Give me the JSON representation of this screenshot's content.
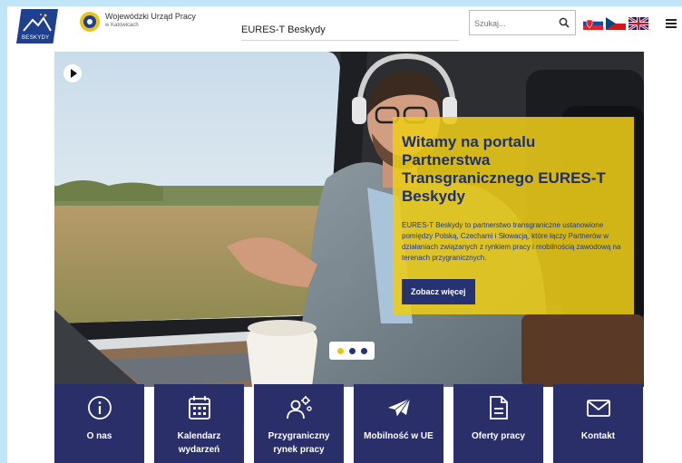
{
  "header": {
    "beskydy_logo_label": "BESKYDY",
    "wup_name_line1": "Wojewódzki Urząd Pracy",
    "wup_name_line2": "w Katowicach",
    "site_title": "EURES-T Beskydy",
    "search_placeholder": "Szukaj...",
    "search_icon": "magnifier-icon",
    "languages": [
      "SK",
      "CZ",
      "EN"
    ],
    "menu_icon": "hamburger-icon"
  },
  "hero": {
    "play_icon": "play-icon",
    "title": "Witamy na portalu Partnerstwa Transgranicznego EURES-T Beskydy",
    "description": "EURES-T Beskydy to partnerstwo transgraniczne ustanowione pomiędzy Polską, Czechami i Słowacją, które łączy Partnerów w działaniach związanych z rynkiem pracy i mobilnością zawodową na terenach przygranicznych.",
    "cta_label": "Zobacz więcej",
    "slides_total": 3,
    "slide_active": 1
  },
  "tiles": [
    {
      "icon": "info-icon",
      "line1": "O nas",
      "line2": ""
    },
    {
      "icon": "calendar-icon",
      "line1": "Kalendarz",
      "line2": "wydarzeń"
    },
    {
      "icon": "people-gear-icon",
      "line1": "Przygraniczny",
      "line2": "rynek pracy"
    },
    {
      "icon": "plane-icon",
      "line1": "Mobilność w UE",
      "line2": ""
    },
    {
      "icon": "document-icon",
      "line1": "Oferty pracy",
      "line2": ""
    },
    {
      "icon": "envelope-icon",
      "line1": "Kontakt",
      "line2": ""
    }
  ],
  "colors": {
    "page_border": "#bfe6f7",
    "navy": "#2b2f69",
    "yellow": "#ecc818",
    "logo_blue": "#1f3f8f"
  }
}
